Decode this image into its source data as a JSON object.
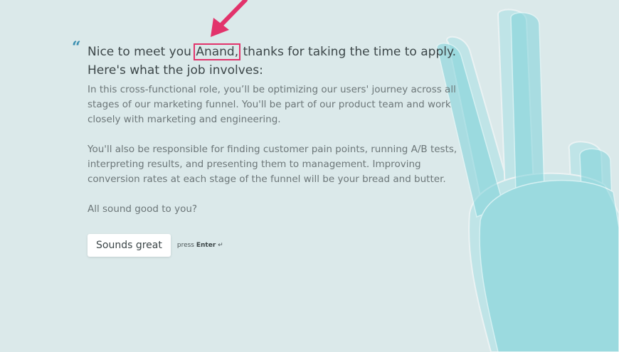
{
  "question": {
    "greeting_prefix": "Nice to meet you",
    "name": "Anand,",
    "greeting_suffix": "thanks for taking the time to apply.",
    "line2": "Here's what the job involves:"
  },
  "description": {
    "paragraph1": "In this cross-functional role, you’ll be optimizing our users' journey across all stages of our marketing funnel. You'll be part of our product team and work closely with marketing and engineering.",
    "paragraph2": "You'll also be responsible for finding customer pain points, running A/B tests, interpreting results, and presenting them to management. Improving conversion rates at each stage of the funnel will be your bread and butter.",
    "paragraph3": "All sound good to you?"
  },
  "answer": {
    "button_label": "Sounds great",
    "hint_prefix": "press",
    "hint_key": "Enter",
    "hint_symbol": "↵"
  },
  "quote_mark": "“",
  "colors": {
    "background": "#dbe9ea",
    "accent_quote": "#3a8fb0",
    "highlight": "#e2336b",
    "hand": "#7fd3da"
  },
  "icons": {
    "quote": "quote-icon",
    "enter": "enter-key-icon",
    "annotation": "annotation-arrow-icon",
    "illustration": "hand-gesture-illustration"
  }
}
